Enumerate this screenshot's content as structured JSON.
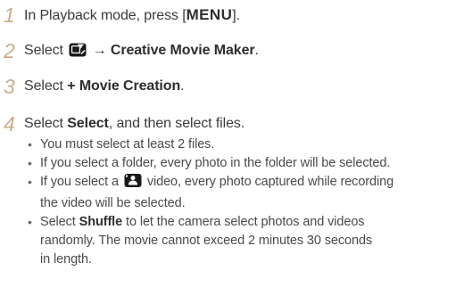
{
  "steps": [
    {
      "number": "1",
      "text_before": "In Playback mode, press [",
      "key": "MENU",
      "text_after": "]."
    },
    {
      "number": "2",
      "text_before": "Select",
      "icon": "creative-movie-icon",
      "arrow": "→",
      "bold": "Creative Movie Maker",
      "text_after": "."
    },
    {
      "number": "3",
      "text_before": "Select",
      "bold": "+ Movie Creation",
      "text_after": "."
    },
    {
      "number": "4",
      "text_before": "Select",
      "bold": "Select",
      "text_after": ", and then select files."
    }
  ],
  "bullets": [
    {
      "bullet": "•",
      "text": "You must select at least 2 files."
    },
    {
      "bullet": "•",
      "text": "If you select a folder, every photo in the folder will be selected."
    },
    {
      "bullet": "•",
      "line1_before": "If you select a",
      "icon": "video-person-icon",
      "line1_after": "video, every photo captured while recording",
      "line2": "the video will be selected."
    },
    {
      "bullet": "•",
      "before": "Select",
      "bold": "Shuffle",
      "line1_after": "to let the camera select photos and videos",
      "line2": "randomly. The movie cannot exceed 2 minutes 30 seconds",
      "line3": "in length."
    }
  ]
}
